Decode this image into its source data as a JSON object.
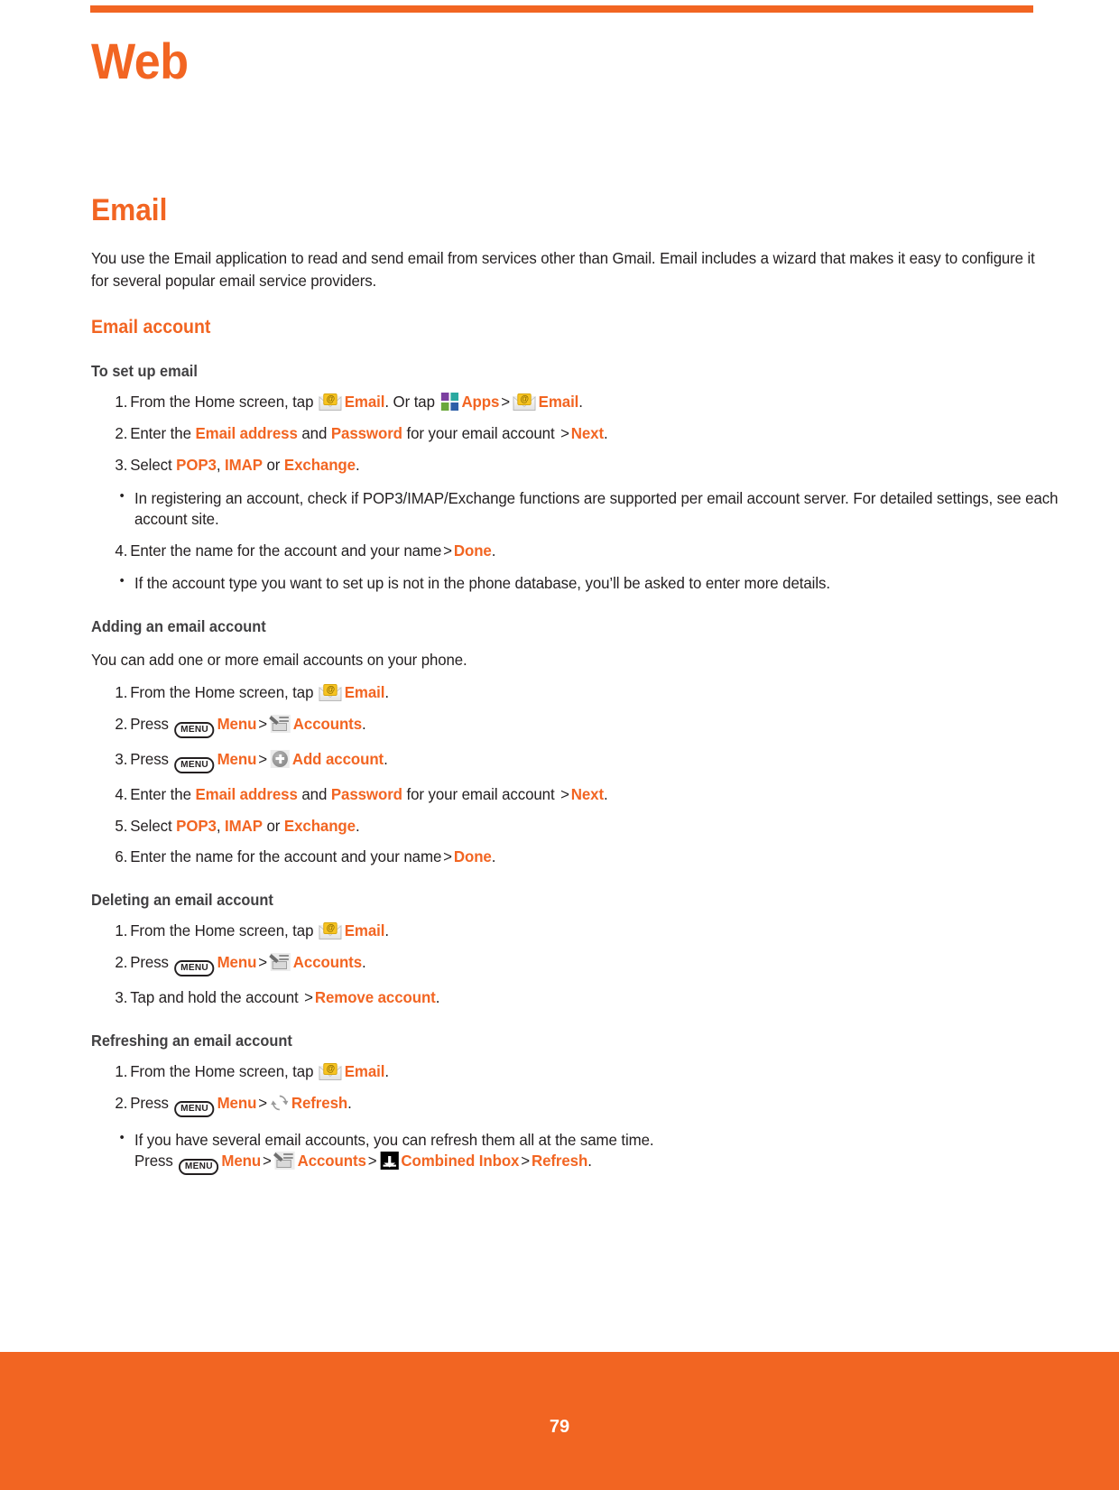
{
  "meta": {
    "accent_color": "#f26522",
    "body_color": "#231f20",
    "subhead_color": "#414042"
  },
  "chapter": {
    "title": "Web"
  },
  "section": {
    "title": "Email",
    "intro": "You use the Email application to read and send email from services other than Gmail. Email includes a wizard that makes it easy to configure it for several popular email service providers."
  },
  "subsection": {
    "title": "Email account"
  },
  "procedures": [
    {
      "title": "To set up email",
      "steps": [
        {
          "num": "1.",
          "parts": [
            {
              "t": "text",
              "v": "From the Home screen, tap "
            },
            {
              "t": "icon",
              "v": "email-icon"
            },
            {
              "t": "accent",
              "v": "Email"
            },
            {
              "t": "text",
              "v": ". Or tap "
            },
            {
              "t": "icon",
              "v": "apps-icon"
            },
            {
              "t": "accent",
              "v": "Apps"
            },
            {
              "t": "gt",
              "v": ">"
            },
            {
              "t": "icon",
              "v": "email-icon"
            },
            {
              "t": "accent",
              "v": "Email"
            },
            {
              "t": "text",
              "v": "."
            }
          ]
        },
        {
          "num": "2.",
          "parts": [
            {
              "t": "text",
              "v": "Enter the "
            },
            {
              "t": "accent",
              "v": "Email address"
            },
            {
              "t": "text",
              "v": " and "
            },
            {
              "t": "accent",
              "v": "Password"
            },
            {
              "t": "text",
              "v": " for your email account "
            },
            {
              "t": "gt",
              "v": ">"
            },
            {
              "t": "accent",
              "v": "Next"
            },
            {
              "t": "text",
              "v": "."
            }
          ]
        },
        {
          "num": "3.",
          "parts": [
            {
              "t": "text",
              "v": "Select "
            },
            {
              "t": "accent",
              "v": "POP3"
            },
            {
              "t": "text",
              "v": ", "
            },
            {
              "t": "accent",
              "v": "IMAP"
            },
            {
              "t": "text",
              "v": " or "
            },
            {
              "t": "accent",
              "v": "Exchange"
            },
            {
              "t": "text",
              "v": "."
            }
          ]
        }
      ],
      "note_after_step3": "In registering an account, check if POP3/IMAP/Exchange functions are supported per email account server. For detailed settings, see each account site.",
      "steps_tail": [
        {
          "num": "4.",
          "parts": [
            {
              "t": "text",
              "v": "Enter the name for the account and your name"
            },
            {
              "t": "gt",
              "v": ">"
            },
            {
              "t": "accent",
              "v": "Done"
            },
            {
              "t": "text",
              "v": "."
            }
          ]
        }
      ],
      "note_after_step4": " If the account type you want to set up is not in the phone database, you’ll be asked to enter more details."
    },
    {
      "title": "Adding an email account",
      "lead": "You can add one or more email accounts on your phone.",
      "steps": [
        {
          "num": "1.",
          "parts": [
            {
              "t": "text",
              "v": "From the Home screen, tap "
            },
            {
              "t": "icon",
              "v": "email-icon"
            },
            {
              "t": "accent",
              "v": "Email"
            },
            {
              "t": "text",
              "v": "."
            }
          ]
        },
        {
          "num": "2.",
          "parts": [
            {
              "t": "text",
              "v": "Press "
            },
            {
              "t": "icon",
              "v": "menu-key-icon"
            },
            {
              "t": "accent",
              "v": "Menu"
            },
            {
              "t": "gt",
              "v": ">"
            },
            {
              "t": "icon",
              "v": "accounts-icon"
            },
            {
              "t": "accent",
              "v": "Accounts"
            },
            {
              "t": "text",
              "v": "."
            }
          ]
        },
        {
          "num": "3.",
          "parts": [
            {
              "t": "text",
              "v": "Press "
            },
            {
              "t": "icon",
              "v": "menu-key-icon"
            },
            {
              "t": "accent",
              "v": "Menu"
            },
            {
              "t": "gt",
              "v": ">"
            },
            {
              "t": "icon",
              "v": "add-account-icon"
            },
            {
              "t": "accent",
              "v": "Add account"
            },
            {
              "t": "text",
              "v": "."
            }
          ]
        },
        {
          "num": "4.",
          "parts": [
            {
              "t": "text",
              "v": "Enter the "
            },
            {
              "t": "accent",
              "v": "Email address"
            },
            {
              "t": "text",
              "v": " and "
            },
            {
              "t": "accent",
              "v": "Password"
            },
            {
              "t": "text",
              "v": " for your email account "
            },
            {
              "t": "gt",
              "v": ">"
            },
            {
              "t": "accent",
              "v": "Next"
            },
            {
              "t": "text",
              "v": "."
            }
          ]
        },
        {
          "num": "5.",
          "parts": [
            {
              "t": "text",
              "v": "Select "
            },
            {
              "t": "accent",
              "v": "POP3"
            },
            {
              "t": "text",
              "v": ", "
            },
            {
              "t": "accent",
              "v": "IMAP"
            },
            {
              "t": "text",
              "v": " or "
            },
            {
              "t": "accent",
              "v": "Exchange"
            },
            {
              "t": "text",
              "v": "."
            }
          ]
        },
        {
          "num": "6.",
          "parts": [
            {
              "t": "text",
              "v": "Enter the name for the account and your name"
            },
            {
              "t": "gt",
              "v": ">"
            },
            {
              "t": "accent",
              "v": "Done"
            },
            {
              "t": "text",
              "v": "."
            }
          ]
        }
      ]
    },
    {
      "title": "Deleting an email account",
      "steps": [
        {
          "num": "1.",
          "parts": [
            {
              "t": "text",
              "v": "From the Home screen, tap "
            },
            {
              "t": "icon",
              "v": "email-icon"
            },
            {
              "t": "accent",
              "v": "Email"
            },
            {
              "t": "text",
              "v": "."
            }
          ]
        },
        {
          "num": "2.",
          "parts": [
            {
              "t": "text",
              "v": "Press "
            },
            {
              "t": "icon",
              "v": "menu-key-icon"
            },
            {
              "t": "accent",
              "v": "Menu"
            },
            {
              "t": "gt",
              "v": ">"
            },
            {
              "t": "icon",
              "v": "accounts-icon"
            },
            {
              "t": "accent",
              "v": "Accounts"
            },
            {
              "t": "text",
              "v": "."
            }
          ]
        },
        {
          "num": "3.",
          "parts": [
            {
              "t": "text",
              "v": "Tap and hold the account "
            },
            {
              "t": "gt",
              "v": ">"
            },
            {
              "t": "accent",
              "v": "Remove account"
            },
            {
              "t": "text",
              "v": "."
            }
          ]
        }
      ]
    },
    {
      "title": "Refreshing an email account",
      "steps": [
        {
          "num": "1.",
          "parts": [
            {
              "t": "text",
              "v": "From the Home screen, tap "
            },
            {
              "t": "icon",
              "v": "email-icon"
            },
            {
              "t": "accent",
              "v": "Email"
            },
            {
              "t": "text",
              "v": "."
            }
          ]
        },
        {
          "num": "2.",
          "parts": [
            {
              "t": "text",
              "v": "Press "
            },
            {
              "t": "icon",
              "v": "menu-key-icon"
            },
            {
              "t": "accent",
              "v": "Menu"
            },
            {
              "t": "gt",
              "v": ">"
            },
            {
              "t": "icon",
              "v": "refresh-icon"
            },
            {
              "t": "accent",
              "v": "Refresh"
            },
            {
              "t": "text",
              "v": "."
            }
          ]
        }
      ],
      "final_note_line1": "If you have several email accounts, you can refresh them all at the same time.",
      "final_note_line2_parts": [
        {
          "t": "text",
          "v": "Press "
        },
        {
          "t": "icon",
          "v": "menu-key-icon"
        },
        {
          "t": "accent",
          "v": "Menu"
        },
        {
          "t": "gt",
          "v": ">"
        },
        {
          "t": "icon",
          "v": "accounts-icon"
        },
        {
          "t": "accent",
          "v": "Accounts"
        },
        {
          "t": "gt",
          "v": ">"
        },
        {
          "t": "icon",
          "v": "combined-inbox-icon"
        },
        {
          "t": "accent",
          "v": "Combined Inbox"
        },
        {
          "t": "gt",
          "v": ">"
        },
        {
          "t": "accent",
          "v": "Refresh"
        },
        {
          "t": "text",
          "v": "."
        }
      ]
    }
  ],
  "icons": {
    "menu_key_label": "MENU",
    "email_at_glyph": "@",
    "bullet_glyph": "•"
  },
  "footer": {
    "page_number": "79"
  }
}
